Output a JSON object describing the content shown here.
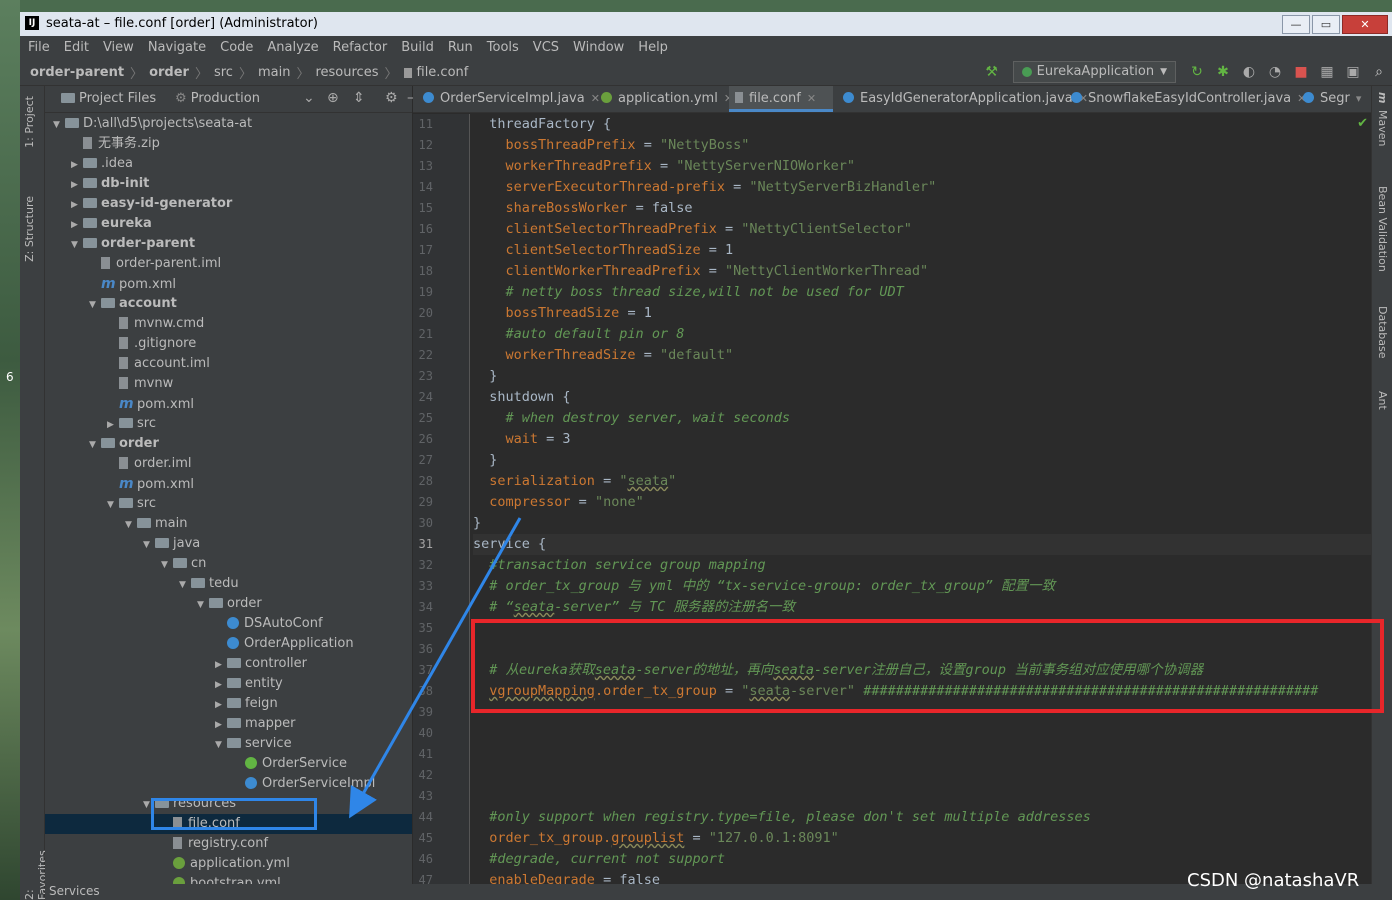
{
  "window": {
    "title": "seata-at – file.conf [order] (Administrator)",
    "buttons": {
      "minimize": "—",
      "maximize": "▭",
      "close": "✕"
    }
  },
  "menu": [
    "File",
    "Edit",
    "View",
    "Navigate",
    "Code",
    "Analyze",
    "Refactor",
    "Build",
    "Run",
    "Tools",
    "VCS",
    "Window",
    "Help"
  ],
  "breadcrumb": {
    "items": [
      "order-parent",
      "order",
      "src",
      "main",
      "resources",
      "file.conf"
    ]
  },
  "toolbar": {
    "run_config": "EurekaApplication"
  },
  "side_tabs": {
    "left": [
      "1: Project",
      "Z: Structure",
      "2: Favorites"
    ],
    "right": [
      "Maven",
      "Bean Validation",
      "Database",
      "Ant"
    ]
  },
  "project_panel": {
    "tabs": [
      "Project Files",
      "Production"
    ],
    "tree": [
      {
        "label": "D:\\all\\d5\\projects\\seata-at",
        "depth": 0,
        "type": "folder",
        "expanded": true
      },
      {
        "label": "无事务.zip",
        "depth": 1,
        "type": "file"
      },
      {
        "label": ".idea",
        "depth": 1,
        "type": "folder",
        "expanded": false
      },
      {
        "label": "db-init",
        "depth": 1,
        "type": "folder",
        "expanded": false,
        "bold": true
      },
      {
        "label": "easy-id-generator",
        "depth": 1,
        "type": "folder",
        "expanded": false,
        "bold": true
      },
      {
        "label": "eureka",
        "depth": 1,
        "type": "folder",
        "expanded": false,
        "bold": true
      },
      {
        "label": "order-parent",
        "depth": 1,
        "type": "folder",
        "expanded": true,
        "bold": true
      },
      {
        "label": "order-parent.iml",
        "depth": 2,
        "type": "file"
      },
      {
        "label": "pom.xml",
        "depth": 2,
        "type": "maven"
      },
      {
        "label": "account",
        "depth": 2,
        "type": "folder",
        "expanded": true,
        "bold": true
      },
      {
        "label": "mvnw.cmd",
        "depth": 3,
        "type": "file"
      },
      {
        "label": ".gitignore",
        "depth": 3,
        "type": "file"
      },
      {
        "label": "account.iml",
        "depth": 3,
        "type": "file"
      },
      {
        "label": "mvnw",
        "depth": 3,
        "type": "file"
      },
      {
        "label": "pom.xml",
        "depth": 3,
        "type": "maven"
      },
      {
        "label": "src",
        "depth": 3,
        "type": "folder",
        "expanded": false
      },
      {
        "label": "order",
        "depth": 2,
        "type": "folder",
        "expanded": true,
        "bold": true
      },
      {
        "label": "order.iml",
        "depth": 3,
        "type": "file"
      },
      {
        "label": "pom.xml",
        "depth": 3,
        "type": "maven"
      },
      {
        "label": "src",
        "depth": 3,
        "type": "folder",
        "expanded": true
      },
      {
        "label": "main",
        "depth": 4,
        "type": "folder",
        "expanded": true
      },
      {
        "label": "java",
        "depth": 5,
        "type": "folder",
        "expanded": true
      },
      {
        "label": "cn",
        "depth": 6,
        "type": "folder",
        "expanded": true
      },
      {
        "label": "tedu",
        "depth": 7,
        "type": "folder",
        "expanded": true
      },
      {
        "label": "order",
        "depth": 8,
        "type": "folder",
        "expanded": true
      },
      {
        "label": "DSAutoConf",
        "depth": 9,
        "type": "class"
      },
      {
        "label": "OrderApplication",
        "depth": 9,
        "type": "class"
      },
      {
        "label": "controller",
        "depth": 9,
        "type": "folder",
        "expanded": false
      },
      {
        "label": "entity",
        "depth": 9,
        "type": "folder",
        "expanded": false
      },
      {
        "label": "feign",
        "depth": 9,
        "type": "folder",
        "expanded": false
      },
      {
        "label": "mapper",
        "depth": 9,
        "type": "folder",
        "expanded": false
      },
      {
        "label": "service",
        "depth": 9,
        "type": "folder",
        "expanded": true
      },
      {
        "label": "OrderService",
        "depth": 10,
        "type": "interface"
      },
      {
        "label": "OrderServiceImpl",
        "depth": 10,
        "type": "class"
      },
      {
        "label": "resources",
        "depth": 5,
        "type": "folder",
        "expanded": true
      },
      {
        "label": "file.conf",
        "depth": 6,
        "type": "file",
        "selected": true
      },
      {
        "label": "registry.conf",
        "depth": 6,
        "type": "file"
      },
      {
        "label": "application.yml",
        "depth": 6,
        "type": "yml"
      },
      {
        "label": "bootstrap.yml",
        "depth": 6,
        "type": "yml"
      }
    ]
  },
  "editor": {
    "tabs": [
      {
        "label": "OrderServiceImpl.java",
        "type": "class"
      },
      {
        "label": "application.yml",
        "type": "yml"
      },
      {
        "label": "file.conf",
        "type": "file",
        "active": true
      },
      {
        "label": "EasyIdGeneratorApplication.java",
        "type": "class"
      },
      {
        "label": "SnowflakeEasyIdController.java",
        "type": "class"
      },
      {
        "label": "Segr",
        "type": "class"
      }
    ],
    "current_line": 31,
    "lines": [
      {
        "n": 11,
        "html": "  threadFactory {"
      },
      {
        "n": 12,
        "html": "    <span class='k'>bossThreadPrefix</span> = <span class='s'>\"NettyBoss\"</span>"
      },
      {
        "n": 13,
        "html": "    <span class='k'>workerThreadPrefix</span> = <span class='s'>\"NettyServerNIOWorker\"</span>"
      },
      {
        "n": 14,
        "html": "    <span class='k'>serverExecutorThread-prefix</span> = <span class='s'>\"NettyServerBizHandler\"</span>"
      },
      {
        "n": 15,
        "html": "    <span class='k'>shareBossWorker</span> = false"
      },
      {
        "n": 16,
        "html": "    <span class='k'>clientSelectorThreadPrefix</span> = <span class='s'>\"NettyClientSelector\"</span>"
      },
      {
        "n": 17,
        "html": "    <span class='k'>clientSelectorThreadSize</span> = 1"
      },
      {
        "n": 18,
        "html": "    <span class='k'>clientWorkerThreadPrefix</span> = <span class='s'>\"NettyClientWorkerThread\"</span>"
      },
      {
        "n": 19,
        "html": "    <span class='cm'># netty boss thread size,will not be used for UDT</span>"
      },
      {
        "n": 20,
        "html": "    <span class='k'>bossThreadSize</span> = 1"
      },
      {
        "n": 21,
        "html": "    <span class='cm'>#auto default pin or 8</span>"
      },
      {
        "n": 22,
        "html": "    <span class='k'>workerThreadSize</span> = <span class='s'>\"default\"</span>"
      },
      {
        "n": 23,
        "html": "  }"
      },
      {
        "n": 24,
        "html": "  shutdown {"
      },
      {
        "n": 25,
        "html": "    <span class='cm'># when destroy server, wait seconds</span>"
      },
      {
        "n": 26,
        "html": "    <span class='k'>wait</span> = 3"
      },
      {
        "n": 27,
        "html": "  }"
      },
      {
        "n": 28,
        "html": "  <span class='k'>serialization</span> = <span class='s'>\"<span class='u'>seata</span>\"</span>"
      },
      {
        "n": 29,
        "html": "  <span class='k'>compressor</span> = <span class='s'>\"none\"</span>"
      },
      {
        "n": 30,
        "html": "}"
      },
      {
        "n": 31,
        "html": "service {"
      },
      {
        "n": 32,
        "html": "  <span class='cm'>#transaction service group mapping</span>"
      },
      {
        "n": 33,
        "html": "  <span class='cm'># order_tx_group 与 yml 中的 “tx-service-group: order_tx_group” 配置一致</span>"
      },
      {
        "n": 34,
        "html": "  <span class='cm'># “<span class='u'>seata</span>-server” 与 TC 服务器的注册名一致</span>"
      },
      {
        "n": 35,
        "html": ""
      },
      {
        "n": 36,
        "html": ""
      },
      {
        "n": 37,
        "html": "  <span class='cm'># 从eureka获取<span class='u'>seata</span>-server的地址，再向<span class='u'>seata</span>-server注册自己，设置group 当前事务组对应使用哪个协调器</span>"
      },
      {
        "n": 38,
        "html": "  <span class='k u'>vgroupMapping</span><span class='k'>.order_tx_group</span> = <span class='s'>\"<span class='u'>seata</span>-server\"</span> <span class='cm'>########################################################</span>"
      },
      {
        "n": 39,
        "html": ""
      },
      {
        "n": 40,
        "html": ""
      },
      {
        "n": 41,
        "html": ""
      },
      {
        "n": 42,
        "html": ""
      },
      {
        "n": 43,
        "html": ""
      },
      {
        "n": 44,
        "html": "  <span class='cm'>#only support when registry.type=file, please don't set multiple addresses</span>"
      },
      {
        "n": 45,
        "html": "  <span class='k'>order_tx_group.<span class='u'>grouplist</span></span> = <span class='s'>\"127.0.0.1:8091\"</span>"
      },
      {
        "n": 46,
        "html": "  <span class='cm'>#degrade, current not support</span>"
      },
      {
        "n": 47,
        "html": "  <span class='k'>enableDegrade</span> = false"
      }
    ]
  },
  "status": {
    "services_label": "Services"
  },
  "watermark": "CSDN @natashaVR",
  "desktop_text": "6"
}
